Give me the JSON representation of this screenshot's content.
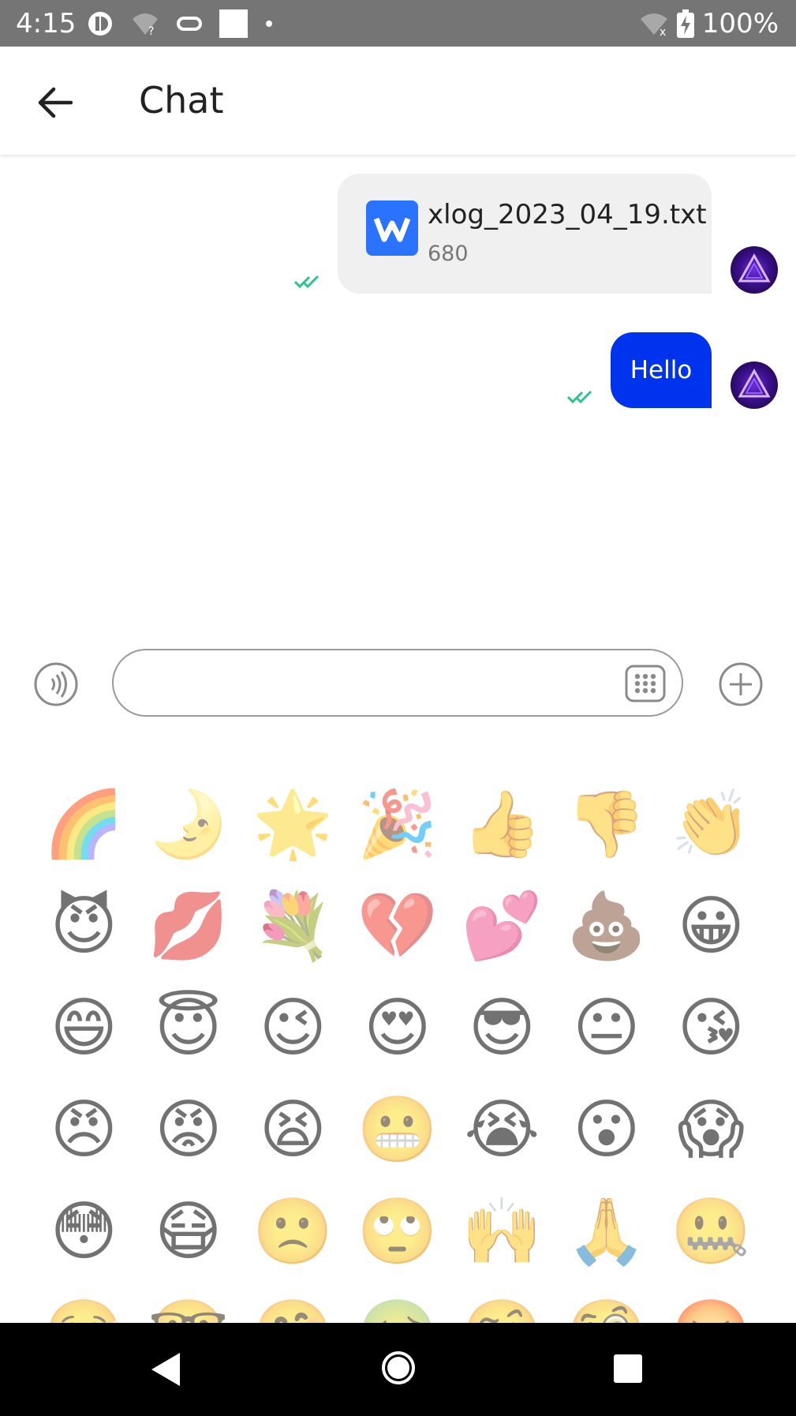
{
  "status_bar": {
    "time": "4:15",
    "battery": "100%"
  },
  "header": {
    "title": "Chat",
    "back_icon": "arrow-left-icon"
  },
  "messages": [
    {
      "type": "file",
      "file_name": "xlog_2023_04_19.txt",
      "file_size": "680",
      "status": "read"
    },
    {
      "type": "text",
      "text": "Hello",
      "status": "read"
    }
  ],
  "composer": {
    "placeholder": "",
    "value": "",
    "voice_icon": "voice-icon",
    "keyboard_icon": "keyboard-icon",
    "plus_icon": "plus-icon"
  },
  "emojis": [
    "🌈",
    "🌛",
    "🌟",
    "🎉",
    "👍",
    "👎",
    "👏",
    "😈",
    "💋",
    "💐",
    "💔",
    "💕",
    "💩",
    "😀",
    "😄",
    "😇",
    "😉",
    "😍",
    "😎",
    "😐",
    "😘",
    "😠",
    "😡",
    "😫",
    "😬",
    "😭",
    "😮",
    "😱",
    "😳",
    "😷",
    "🙁",
    "🙄",
    "🙌",
    "🙏",
    "🤐",
    "🤒",
    "🤓",
    "🤗",
    "🤢",
    "🤨",
    "🧐",
    "🤬"
  ],
  "colors": {
    "sent_bubble": "#0033ee",
    "file_bubble": "#f0f0f0",
    "read_tick": "#2bc48a",
    "status_bar": "#757575"
  }
}
